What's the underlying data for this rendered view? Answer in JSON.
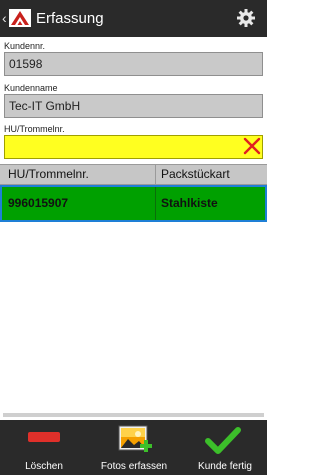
{
  "header": {
    "back_glyph": "‹",
    "title": "Erfassung",
    "logo_icon": "app-logo-icon",
    "settings_icon": "gear-icon"
  },
  "form": {
    "customer_number_label": "Kundennr.",
    "customer_number_value": "01598",
    "customer_name_label": "Kundenname",
    "customer_name_value": "Tec-IT GmbH",
    "drum_label": "HU/Trommelnr.",
    "drum_value": ""
  },
  "table": {
    "headers": [
      "HU/Trommelnr.",
      "Packstückart"
    ],
    "rows": [
      {
        "number": "996015907",
        "type": "Stahlkiste"
      }
    ]
  },
  "toolbar": {
    "delete_label": "Löschen",
    "photos_label": "Fotos erfassen",
    "finish_label": "Kunde fertig"
  },
  "colors": {
    "app_bar": "#2a2a2a",
    "active_field": "#ffff20",
    "selected_row": "#00a000",
    "row_border": "#1e7fd6",
    "delete_red": "#e0302a",
    "check_green": "#3cbf2a"
  }
}
